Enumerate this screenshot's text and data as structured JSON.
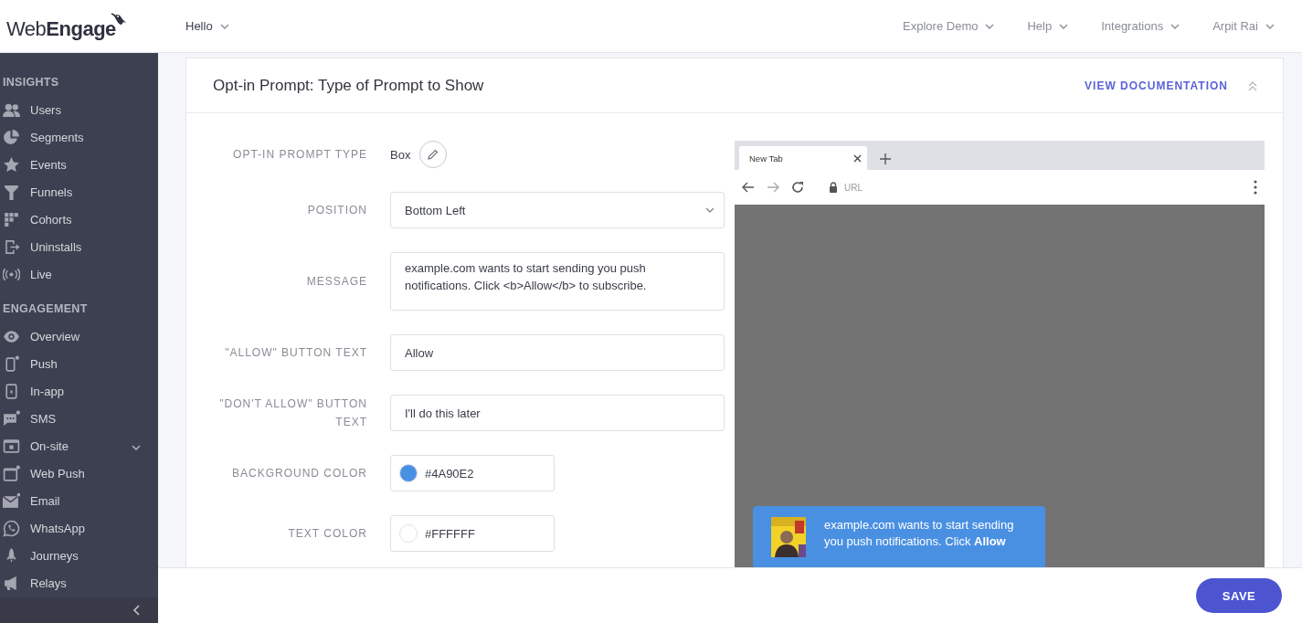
{
  "header": {
    "logo": "Web**Engage**",
    "project": "Hello",
    "menus": [
      "Explore Demo",
      "Help",
      "Integrations",
      "Arpit Rai"
    ]
  },
  "sidebar": {
    "sections": [
      {
        "title": "INSIGHTS",
        "items": [
          {
            "label": "Users",
            "expandable": false
          },
          {
            "label": "Segments",
            "expandable": false
          },
          {
            "label": "Events",
            "expandable": false
          },
          {
            "label": "Funnels",
            "expandable": false
          },
          {
            "label": "Cohorts",
            "expandable": false
          },
          {
            "label": "Uninstalls",
            "expandable": false
          },
          {
            "label": "Live",
            "expandable": false
          }
        ]
      },
      {
        "title": "ENGAGEMENT",
        "items": [
          {
            "label": "Overview",
            "expandable": false
          },
          {
            "label": "Push",
            "expandable": false
          },
          {
            "label": "In-app",
            "expandable": false
          },
          {
            "label": "SMS",
            "expandable": false
          },
          {
            "label": "On-site",
            "expandable": true
          },
          {
            "label": "Web Push",
            "expandable": false
          },
          {
            "label": "Email",
            "expandable": false
          },
          {
            "label": "WhatsApp",
            "expandable": false
          },
          {
            "label": "Journeys",
            "expandable": false
          },
          {
            "label": "Relays",
            "expandable": false
          }
        ]
      }
    ]
  },
  "card": {
    "title": "Opt-in Prompt: Type of Prompt to Show",
    "doc_link": "VIEW DOCUMENTATION",
    "fields": [
      {
        "kind": "value",
        "label": "OPT-IN PROMPT TYPE",
        "value": "Box"
      },
      {
        "kind": "select",
        "label": "POSITION",
        "value": "Bottom Left"
      },
      {
        "kind": "textarea",
        "label": "MESSAGE",
        "value": "example.com wants to start sending you push notifications. Click <b>Allow</b> to subscribe."
      },
      {
        "kind": "text",
        "label": "\"ALLOW\" BUTTON TEXT",
        "value": "Allow"
      },
      {
        "kind": "text",
        "label": "\"DON'T ALLOW\" BUTTON TEXT",
        "value": "I'll do this later"
      },
      {
        "kind": "color",
        "label": "BACKGROUND COLOR",
        "value": "#4A90E2",
        "color": "#4a90e2"
      },
      {
        "kind": "color",
        "label": "TEXT COLOR",
        "value": "#FFFFFF",
        "color": "#ffffff"
      }
    ]
  },
  "preview": {
    "tab": "New Tab",
    "url_placeholder": "URL",
    "notification": {
      "text": "example.com wants to start sending you push notifications. Click **Allow**",
      "color": "#4a90e2"
    }
  },
  "save": "SAVE"
}
